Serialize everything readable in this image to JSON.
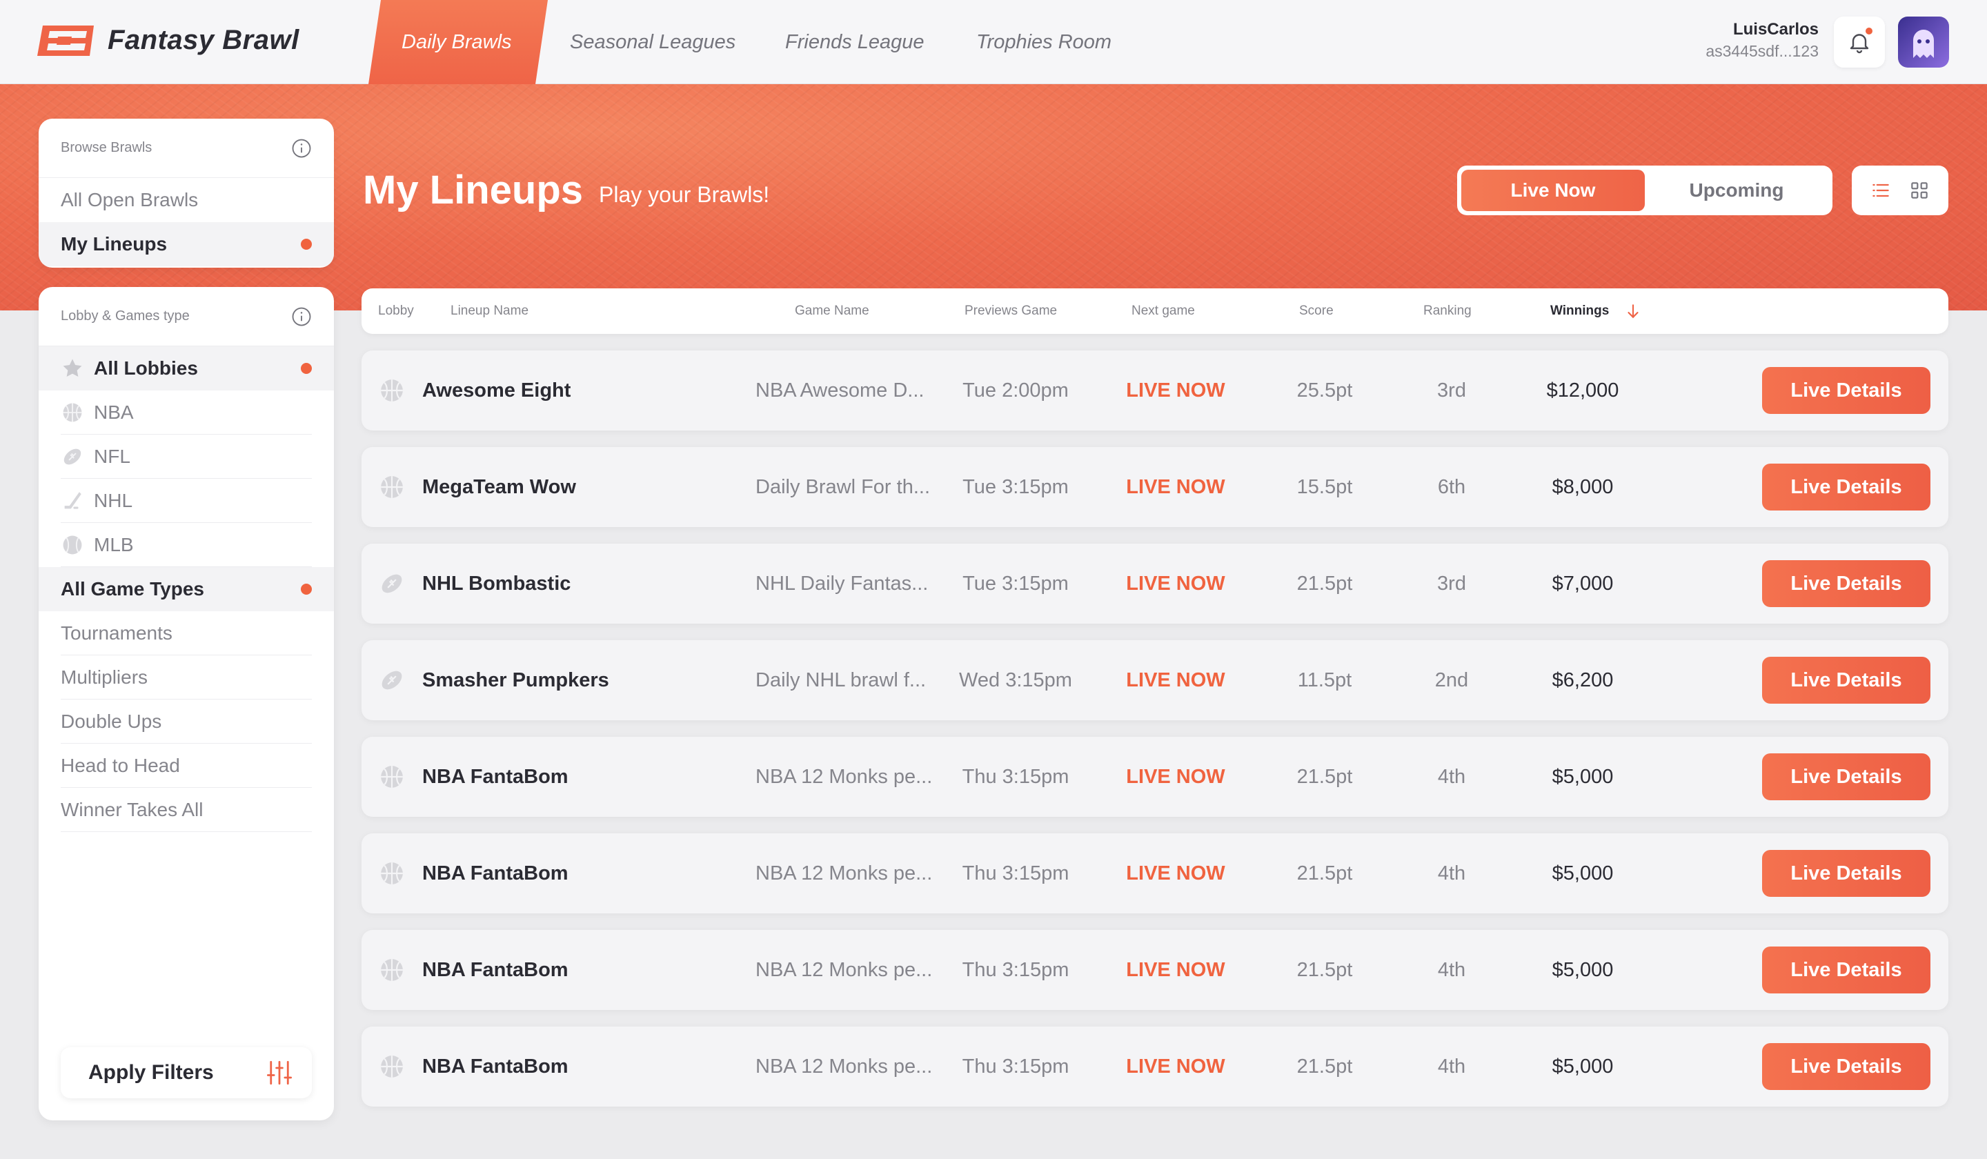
{
  "brand": {
    "name": "Fantasy Brawl",
    "accent": "#ef6447"
  },
  "nav": {
    "tabs": [
      {
        "label": "Daily Brawls",
        "active": true
      },
      {
        "label": "Seasonal Leagues",
        "active": false
      },
      {
        "label": "Friends League",
        "active": false
      },
      {
        "label": "Trophies Room",
        "active": false
      }
    ]
  },
  "user": {
    "name": "LuisCarlos",
    "id": "as3445sdf...123",
    "has_notification": true
  },
  "header": {
    "title": "My Lineups",
    "subtitle": "Play your Brawls!",
    "segments": [
      "Live Now",
      "Upcoming"
    ],
    "active_segment": "Live Now",
    "view_icons": [
      "list-view-icon",
      "grid-view-icon"
    ]
  },
  "sidebar": {
    "browse": {
      "label": "Browse Brawls",
      "items": [
        {
          "label": "All Open Brawls",
          "selected": false
        },
        {
          "label": "My Lineups",
          "selected": true
        }
      ]
    },
    "lobby": {
      "label": "Lobby & Games type",
      "lobbies": [
        {
          "label": "All Lobbies",
          "icon": "star-icon",
          "selected": true
        },
        {
          "label": "NBA",
          "icon": "basketball-icon",
          "selected": false
        },
        {
          "label": "NFL",
          "icon": "football-icon",
          "selected": false
        },
        {
          "label": "NHL",
          "icon": "hockey-stick-icon",
          "selected": false
        },
        {
          "label": "MLB",
          "icon": "baseball-icon",
          "selected": false
        }
      ],
      "game_types": [
        {
          "label": "All Game Types",
          "selected": true
        },
        {
          "label": "Tournaments",
          "selected": false
        },
        {
          "label": "Multipliers",
          "selected": false
        },
        {
          "label": "Double Ups",
          "selected": false
        },
        {
          "label": "Head to Head",
          "selected": false
        },
        {
          "label": "Winner Takes All",
          "selected": false
        }
      ]
    },
    "apply_label": "Apply Filters"
  },
  "table": {
    "columns": {
      "lobby": "Lobby",
      "lineup": "Lineup Name",
      "game": "Game Name",
      "previews": "Previews Game",
      "next": "Next game",
      "score": "Score",
      "ranking": "Ranking",
      "winnings": "Winnings"
    },
    "sorted_by": "Winnings",
    "sort_direction": "desc",
    "action_label": "Live Details",
    "rows": [
      {
        "sport": "basketball-icon",
        "lineup": "Awesome Eight",
        "game": "NBA Awesome D...",
        "previews": "Tue 2:00pm",
        "next": "LIVE NOW",
        "score": "25.5pt",
        "ranking": "3rd",
        "winnings": "$12,000"
      },
      {
        "sport": "basketball-icon",
        "lineup": "MegaTeam Wow",
        "game": "Daily Brawl For th...",
        "previews": "Tue 3:15pm",
        "next": "LIVE NOW",
        "score": "15.5pt",
        "ranking": "6th",
        "winnings": "$8,000"
      },
      {
        "sport": "football-icon",
        "lineup": "NHL Bombastic",
        "game": "NHL Daily Fantas...",
        "previews": "Tue 3:15pm",
        "next": "LIVE NOW",
        "score": "21.5pt",
        "ranking": "3rd",
        "winnings": "$7,000"
      },
      {
        "sport": "football-icon",
        "lineup": "Smasher Pumpkers",
        "game": "Daily NHL brawl f...",
        "previews": "Wed 3:15pm",
        "next": "LIVE NOW",
        "score": "11.5pt",
        "ranking": "2nd",
        "winnings": "$6,200"
      },
      {
        "sport": "basketball-icon",
        "lineup": "NBA FantaBom",
        "game": "NBA 12 Monks pe...",
        "previews": "Thu 3:15pm",
        "next": "LIVE NOW",
        "score": "21.5pt",
        "ranking": "4th",
        "winnings": "$5,000"
      },
      {
        "sport": "basketball-icon",
        "lineup": "NBA FantaBom",
        "game": "NBA 12 Monks pe...",
        "previews": "Thu 3:15pm",
        "next": "LIVE NOW",
        "score": "21.5pt",
        "ranking": "4th",
        "winnings": "$5,000"
      },
      {
        "sport": "basketball-icon",
        "lineup": "NBA FantaBom",
        "game": "NBA 12 Monks pe...",
        "previews": "Thu 3:15pm",
        "next": "LIVE NOW",
        "score": "21.5pt",
        "ranking": "4th",
        "winnings": "$5,000"
      },
      {
        "sport": "basketball-icon",
        "lineup": "NBA FantaBom",
        "game": "NBA 12 Monks pe...",
        "previews": "Thu 3:15pm",
        "next": "LIVE NOW",
        "score": "21.5pt",
        "ranking": "4th",
        "winnings": "$5,000"
      }
    ]
  }
}
